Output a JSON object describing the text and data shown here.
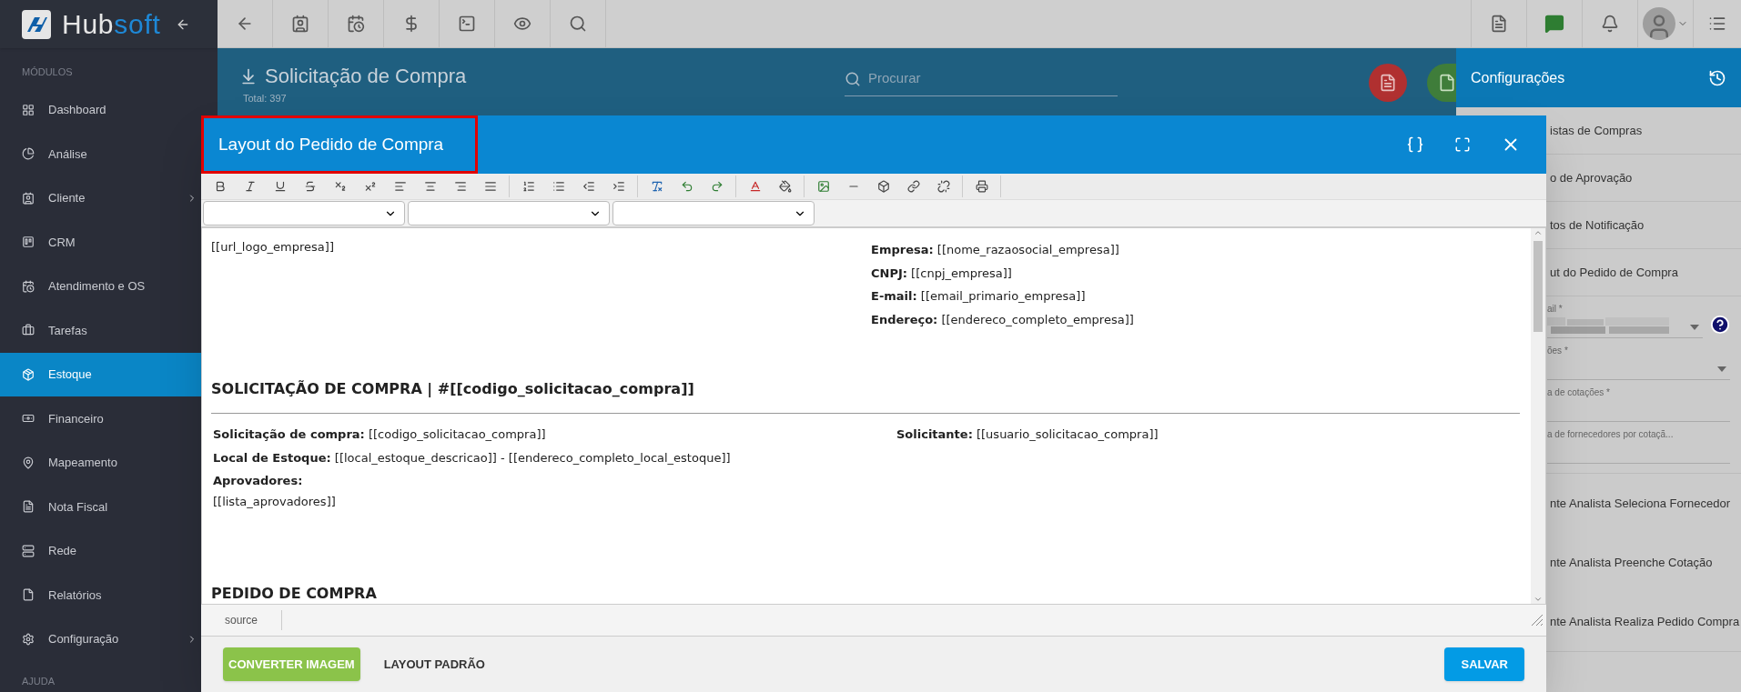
{
  "sidebar": {
    "brand": {
      "first": "Hub",
      "second": "soft"
    },
    "section": "MÓDULOS",
    "items": [
      {
        "label": "Dashboard",
        "selected": false,
        "expandable": false
      },
      {
        "label": "Análise",
        "selected": false,
        "expandable": false
      },
      {
        "label": "Cliente",
        "selected": false,
        "expandable": true
      },
      {
        "label": "CRM",
        "selected": false,
        "expandable": false
      },
      {
        "label": "Atendimento e OS",
        "selected": false,
        "expandable": false
      },
      {
        "label": "Tarefas",
        "selected": false,
        "expandable": false
      },
      {
        "label": "Estoque",
        "selected": true,
        "expandable": false
      },
      {
        "label": "Financeiro",
        "selected": false,
        "expandable": false
      },
      {
        "label": "Mapeamento",
        "selected": false,
        "expandable": false
      },
      {
        "label": "Nota Fiscal",
        "selected": false,
        "expandable": false
      },
      {
        "label": "Rede",
        "selected": false,
        "expandable": false
      },
      {
        "label": "Relatórios",
        "selected": false,
        "expandable": false
      },
      {
        "label": "Configuração",
        "selected": false,
        "expandable": true
      }
    ],
    "help_section": "AJUDA"
  },
  "page_header": {
    "title": "Solicitação de Compra",
    "total": "Total: 397",
    "search": {
      "placeholder": "Procurar"
    }
  },
  "settings_panel": {
    "title": "Configurações",
    "links": [
      "istas de Compras",
      "o de Aprovação",
      "tos de Notificação",
      "ut do Pedido de Compra"
    ],
    "fields": [
      {
        "kind": "select",
        "label": "ail *",
        "help": true
      },
      {
        "kind": "select",
        "label": "ões *",
        "help": false
      },
      {
        "kind": "input",
        "label": "a de cotações *",
        "help": false
      },
      {
        "kind": "input",
        "label": "a de fornecedores por cotaçã...",
        "help": false
      }
    ],
    "options": [
      "nte Analista Seleciona Fornecedor",
      "nte Analista Preenche Cotação",
      "nte Analista Realiza Pedido Compra"
    ]
  },
  "modal": {
    "title": "Layout do Pedido de Compra",
    "highlighted": true,
    "editor": {
      "logo_placeholder": "[[url_logo_empresa]]",
      "company_lines": [
        "**Empresa:** [[nome_razaosocial_empresa]]",
        "**CNPJ:** [[cnpj_empresa]]",
        "**E-mail:** [[email_primario_empresa]]",
        "**Endereço:** [[endereco_completo_empresa]]"
      ],
      "heading": "SOLICITAÇÃO DE COMPRA | #[[codigo_solicitacao_compra]]",
      "left_lines": [
        "**Solicitação de compra:** [[codigo_solicitacao_compra]]",
        "**Local de Estoque:** [[local_estoque_descricao]] - [[endereco_completo_local_estoque]]",
        "**Aprovadores:**",
        "[[lista_aprovadores]]"
      ],
      "right_lines": [
        "**Solicitante:** [[usuario_solicitacao_compra]]"
      ],
      "next_heading": "PEDIDO DE COMPRA"
    },
    "status_tab": "source",
    "buttons": [
      {
        "kind": "convert",
        "label": "CONVERTER IMAGEM"
      },
      {
        "kind": "text",
        "label": "LAYOUT PADRÃO"
      },
      {
        "kind": "save",
        "label": "SALVAR"
      }
    ]
  }
}
